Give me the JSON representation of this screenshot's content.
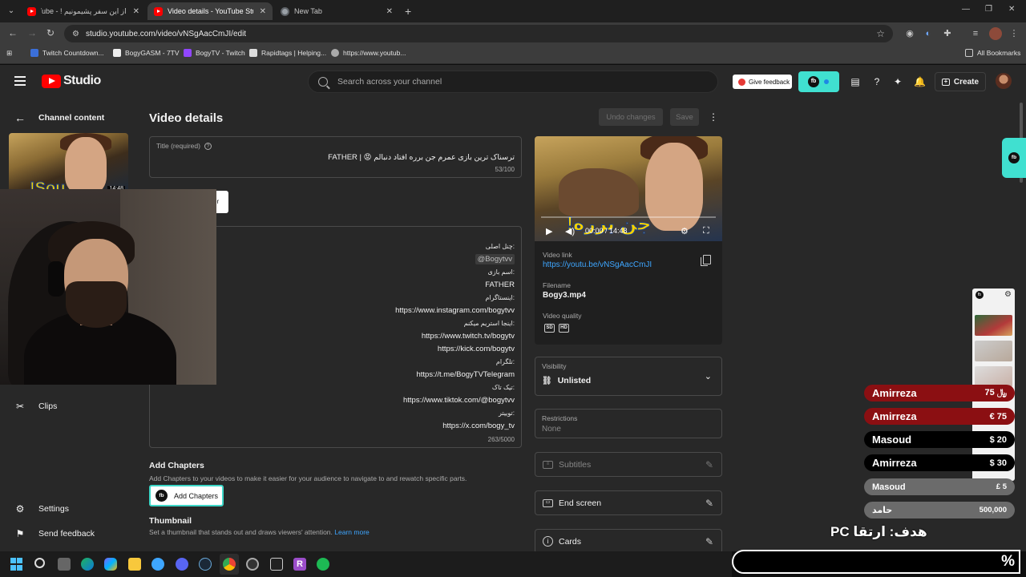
{
  "browser": {
    "tabs": [
      {
        "title": "از این سفر پشیمونیم ! - YouTube",
        "active": false
      },
      {
        "title": "Video details - YouTube Studio",
        "active": true
      },
      {
        "title": "New Tab",
        "active": false
      }
    ],
    "url": "studio.youtube.com/video/vNSgAacCmJI/edit",
    "bookmarks": [
      "Twitch Countdown...",
      "BogyGASM - 7TV",
      "BogyTV - Twitch",
      "Rapidtags | Helping...",
      "https://www.youtub...",
      "All Bookmarks"
    ]
  },
  "header": {
    "logo_text": "Studio",
    "search_placeholder": "Search across your channel",
    "give_feedback": "Give feedback",
    "create_label": "Create"
  },
  "sidebar": {
    "back_label": "Channel content",
    "thumb_duration": "14:48",
    "items": [
      {
        "label": "Clips",
        "icon": "scissors-icon"
      },
      {
        "label": "Settings",
        "icon": "gear-icon"
      },
      {
        "label": "Send feedback",
        "icon": "feedback-icon"
      }
    ]
  },
  "page": {
    "title": "Video details",
    "undo_label": "Undo changes",
    "save_label": "Save",
    "title_field": {
      "label": "Title (required)",
      "value": "ترسناک ترین بازی عمرم جن برره افتاد دنبالم 😡 | FATHER",
      "counter": "53/100"
    },
    "editor_button": "or",
    "description": {
      "lines": [
        {
          "text": "چنل اصلی:",
          "small": true
        },
        {
          "text": "@Bogytvv",
          "chip": true
        },
        {
          "text": "اسم بازی:",
          "small": true
        },
        {
          "text": "FATHER"
        },
        {
          "text": "اینستاگرام:",
          "small": true
        },
        {
          "text": "https://www.instagram.com/bogytvv"
        },
        {
          "text": "اینجا استریم میکنم:",
          "small": true
        },
        {
          "text": "https://www.twitch.tv/bogytv"
        },
        {
          "text": "https://kick.com/bogytv"
        },
        {
          "text": "تلگرام:",
          "small": true
        },
        {
          "text": "https://t.me/BogyTVTelegram"
        },
        {
          "text": "تیک تاک:",
          "small": true
        },
        {
          "text": "https://www.tiktok.com/@bogytvv"
        },
        {
          "text": "توییتر:",
          "small": true
        },
        {
          "text": "https://x.com/bogy_tv"
        }
      ],
      "counter": "263/5000"
    },
    "chapters": {
      "heading": "Add Chapters",
      "sub": "Add Chapters to your videos to make it easier for your audience to navigate to and rewatch specific parts.",
      "button": "Add Chapters"
    },
    "thumbnail": {
      "heading": "Thumbnail",
      "sub": "Set a thumbnail that stands out and draws viewers' attention.",
      "learn_more": "Learn more"
    }
  },
  "video": {
    "time": "00:00 / 14:48",
    "link_label": "Video link",
    "link": "https://youtu.be/vNSgAacCmJI",
    "filename_label": "Filename",
    "filename": "Bogy3.mp4",
    "quality_label": "Video quality",
    "qualities": [
      "SD",
      "HD"
    ],
    "visibility_label": "Visibility",
    "visibility": "Unlisted",
    "restrictions_label": "Restrictions",
    "restrictions": "None",
    "subtitles": "Subtitles",
    "end_screen": "End screen",
    "cards": "Cards"
  },
  "overlay": {
    "donations": [
      {
        "name": "Amirreza",
        "amount": "﷼ 75",
        "style": "red"
      },
      {
        "name": "Amirreza",
        "amount": "€ 75",
        "style": "red"
      },
      {
        "name": "Masoud",
        "amount": "$ 20",
        "style": "black"
      },
      {
        "name": "Amirreza",
        "amount": "$ 30",
        "style": "black"
      },
      {
        "name": "Masoud",
        "amount": "£ 5",
        "style": "grey"
      },
      {
        "name": "حامد",
        "amount": "500,000",
        "style": "grey"
      }
    ],
    "goal": "هدف: ارتقا PC",
    "goal_percent": "%"
  },
  "colors": {
    "accent_teal": "#40e0d0",
    "link_blue": "#3ea6ff",
    "yt_red": "#ff0000",
    "dono_red": "#8b0f12"
  }
}
